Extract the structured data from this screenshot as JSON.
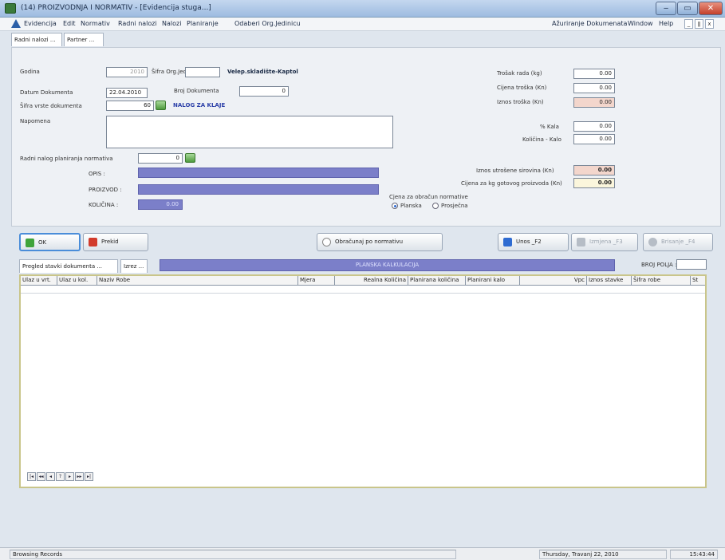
{
  "window": {
    "title": "(14) PROIZVODNJA I NORMATIV - [Evidencija stuga...]",
    "minimize": "‒",
    "maximize": "▭",
    "close": "✕"
  },
  "menu": {
    "items": [
      "Evidencija",
      "Edit",
      "Normativ",
      "Radni nalozi",
      "Nalozi",
      "Planiranje",
      "Odaberi Org.Jedinicu"
    ],
    "right_items": [
      "Ažuriranje Dokumenata",
      "Window",
      "Help"
    ],
    "mdi_buttons": [
      "_",
      "ǁ",
      "x"
    ]
  },
  "tabs": [
    "Radni nalozi ...",
    "Partner ..."
  ],
  "form": {
    "godina_label": "Godina",
    "godina_value": "2010",
    "sifra_org_label": "Šifra Org.Jed.",
    "sifra_org_value": "",
    "org_name": "Velep.skladište-Kaptol",
    "datum_label": "Datum Dokumenta",
    "datum_value": "22.04.2010",
    "broj_label": "Broj Dokumenta",
    "broj_value": "0",
    "sifra_vrste_label": "Šifra vrste dokumenta",
    "sifra_vrste_value": "60",
    "vrsta_name": "NALOG ZA KLAJE",
    "napomena_label": "Napomena",
    "napomena_value": "",
    "radni_nalog_label": "Radni nalog planiranja normativa",
    "radni_nalog_value": "0",
    "opis_label": "OPIS :",
    "proizvod_label": "PROIZVOD :",
    "kolicina_label": "KOLIČINA :",
    "kolicina_value": "0.00"
  },
  "right_form": {
    "trosak_label": "Trošak rada (kg)",
    "trosak_value": "0.00",
    "cijena_troska_label": "Cijena troška (Kn)",
    "cijena_troska_value": "0.00",
    "iznos_troska_label": "Iznos troška (Kn)",
    "iznos_troska_value": "0.00",
    "kalo_pct_label": "% Kala",
    "kalo_pct_value": "0.00",
    "kolicina_kalo_label": "Količina - Kalo",
    "kolicina_kalo_value": "0.00",
    "iznos_sirovina_label": "Iznos utrošene sirovina (Kn)",
    "iznos_sirovina_value": "0.00",
    "cijena_kg_label": "Cijena za kg gotovog proizvoda (Kn)",
    "cijena_kg_value": "0.00",
    "obracun_label": "Cjena za obračun normative",
    "radio_planska": "Planska",
    "radio_prosjecna": "Prosječna"
  },
  "buttons": {
    "ok": "OK",
    "prekid": "Prekid",
    "obracunaj": "Obračunaj po normativu",
    "unos": "Unos _F2",
    "izmjena": "Izmjena _F3",
    "brisanje": "Brisanje _F4"
  },
  "subtabs": {
    "pregled": "Pregled stavki dokumenta ...",
    "izrez": "Izrez ...",
    "calc_bar": "PLANSKA KALKULACIJA",
    "broj_polja_label": "BROJ POLJA :",
    "broj_polja_value": ""
  },
  "grid": {
    "columns": [
      "Ulaz u vrt.",
      "Ulaz u kol.",
      "Naziv Robe",
      "Mjera",
      "Realna Količina",
      "Planirana količina",
      "Planirani kalo",
      "Vpc",
      "Iznos stavke",
      "Šifra robe",
      "St"
    ],
    "nav": [
      "|◂",
      "◂◂",
      "◂",
      "?",
      "▸",
      "▸▸",
      "▸|"
    ]
  },
  "status": {
    "left": "Browsing Records",
    "date": "Thursday, Travanj 22, 2010",
    "time": "15:43:44"
  }
}
